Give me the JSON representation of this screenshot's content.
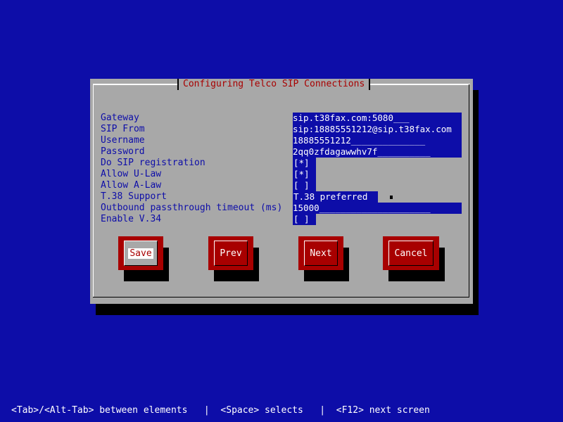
{
  "dialog": {
    "title": "Configuring Telco SIP Connections"
  },
  "form": {
    "labels": {
      "gateway": "Gateway",
      "sip_from": "SIP From",
      "username": "Username",
      "password": "Password",
      "do_sip_registration": "Do SIP registration",
      "allow_ulaw": "Allow U-Law",
      "allow_alaw": "Allow A-Law",
      "t38_support": "T.38 Support",
      "outbound_timeout": "Outbound passthrough timeout (ms)",
      "enable_v34": "Enable V.34"
    },
    "values": {
      "gateway": "sip.t38fax.com:5080___",
      "sip_from": "sip:18885551212@sip.t38fax.com",
      "username": "18885551212______________",
      "password": "2qq0zfdagawwhv7f__________",
      "do_sip_registration": "[*]",
      "allow_ulaw": "[*]",
      "allow_alaw": "[ ]",
      "t38_support": "T.38 preferred",
      "outbound_timeout": "15000_____________________",
      "enable_v34": "[ ]"
    }
  },
  "buttons": {
    "save": "Save",
    "prev": "Prev",
    "next": "Next",
    "cancel": "Cancel"
  },
  "status_bar": {
    "text": "<Tab>/<Alt-Tab> between elements   |  <Space> selects   |  <F12> next screen"
  },
  "colors": {
    "background": "#0d0da8",
    "dialog": "#a8a8a8",
    "title": "#a80000",
    "button": "#a80000",
    "label": "#0d0da8"
  }
}
